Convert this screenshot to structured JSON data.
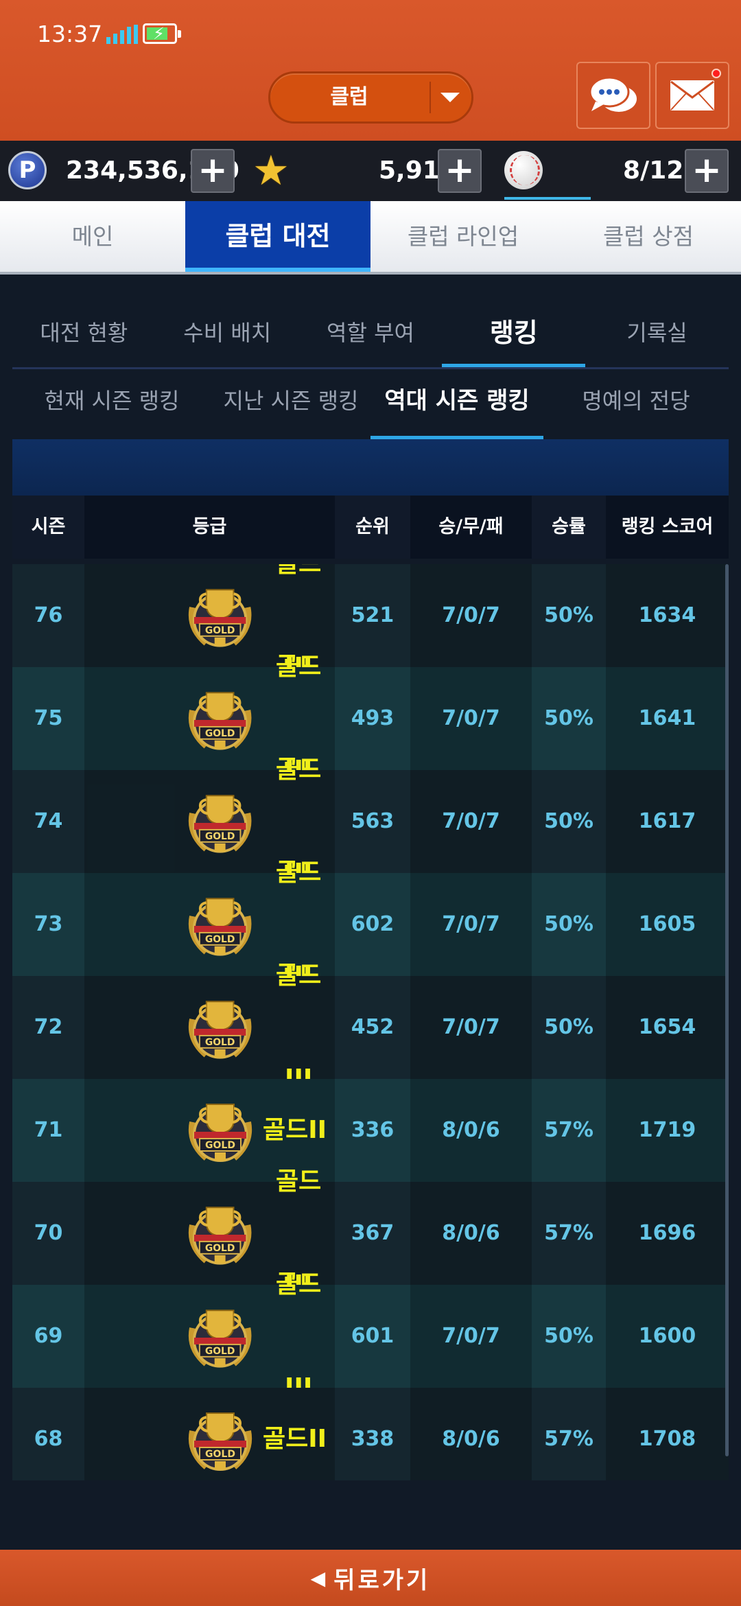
{
  "status_bar": {
    "time": "13:37"
  },
  "header": {
    "club_dropdown_label": "클럽",
    "icons": [
      "chat-bubble-icon",
      "mail-icon"
    ]
  },
  "currency": {
    "points_icon_letter": "P",
    "points": "234,536,100",
    "stars": "5,912",
    "stamina": "8/120"
  },
  "main_tabs": [
    {
      "label": "메인",
      "active": false
    },
    {
      "label": "클럽 대전",
      "active": true
    },
    {
      "label": "클럽 라인업",
      "active": false
    },
    {
      "label": "클럽 상점",
      "active": false
    }
  ],
  "sub_tabs": [
    {
      "label": "대전 현황",
      "active": false
    },
    {
      "label": "수비 배치",
      "active": false
    },
    {
      "label": "역할 부여",
      "active": false
    },
    {
      "label": "랭킹",
      "active": true
    },
    {
      "label": "기록실",
      "active": false
    }
  ],
  "season_tabs": [
    {
      "label": "현재 시즌 랭킹",
      "active": false
    },
    {
      "label": "지난 시즌 랭킹",
      "active": false
    },
    {
      "label": "역대 시즌 랭킹",
      "active": true
    },
    {
      "label": "명예의 전당",
      "active": false
    }
  ],
  "table": {
    "headers": [
      "시즌",
      "등급",
      "순위",
      "승/무/패",
      "승률",
      "랭킹 스코어"
    ],
    "badge_text": "GOLD",
    "rows": [
      {
        "season": "76",
        "grade": "골드III",
        "rank": "521",
        "record": "7/0/7",
        "win_rate": "50%",
        "score": "1634"
      },
      {
        "season": "75",
        "grade": "골드III",
        "rank": "493",
        "record": "7/0/7",
        "win_rate": "50%",
        "score": "1641"
      },
      {
        "season": "74",
        "grade": "골드III",
        "rank": "563",
        "record": "7/0/7",
        "win_rate": "50%",
        "score": "1617"
      },
      {
        "season": "73",
        "grade": "골드III",
        "rank": "602",
        "record": "7/0/7",
        "win_rate": "50%",
        "score": "1605"
      },
      {
        "season": "72",
        "grade": "골드III",
        "rank": "452",
        "record": "7/0/7",
        "win_rate": "50%",
        "score": "1654"
      },
      {
        "season": "71",
        "grade": "골드II",
        "rank": "336",
        "record": "8/0/6",
        "win_rate": "57%",
        "score": "1719"
      },
      {
        "season": "70",
        "grade": "골드III",
        "rank": "367",
        "record": "8/0/6",
        "win_rate": "57%",
        "score": "1696"
      },
      {
        "season": "69",
        "grade": "골드III",
        "rank": "601",
        "record": "7/0/7",
        "win_rate": "50%",
        "score": "1600"
      },
      {
        "season": "68",
        "grade": "골드II",
        "rank": "338",
        "record": "8/0/6",
        "win_rate": "57%",
        "score": "1708"
      }
    ]
  },
  "footer": {
    "back_label": "뒤로가기"
  },
  "colors": {
    "header_orange": "#d9582b",
    "active_tab_blue": "#0b3ea8",
    "grade_yellow": "#f1ef1a",
    "value_cyan": "#64c5e6"
  }
}
